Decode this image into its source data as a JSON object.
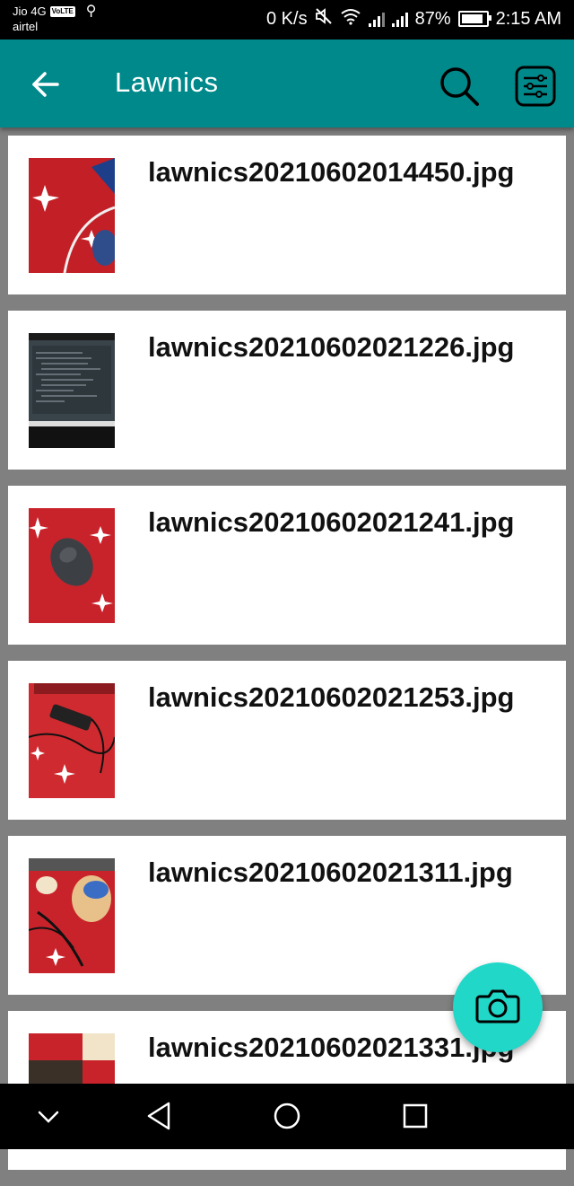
{
  "status_bar": {
    "carrier1": "Jio 4G",
    "volte": "VoLTE",
    "carrier2": "airtel",
    "speed": "0 K/s",
    "battery": "87%",
    "time": "2:15 AM",
    "battery_level": 0.87
  },
  "app_bar": {
    "title": "Lawnics",
    "back_icon": "arrow-left-icon",
    "search_icon": "search-icon",
    "filter_icon": "filter-icon",
    "color": "#00898a"
  },
  "files": [
    {
      "name": "lawnics20210602014450.jpg",
      "thumb": "red-blanket-cable"
    },
    {
      "name": "lawnics20210602021226.jpg",
      "thumb": "laptop-screen"
    },
    {
      "name": "lawnics20210602021241.jpg",
      "thumb": "mouse-on-red-blanket"
    },
    {
      "name": "lawnics20210602021253.jpg",
      "thumb": "phone-on-red-blanket"
    },
    {
      "name": "lawnics20210602021311.jpg",
      "thumb": "cartoon-blanket-cable"
    },
    {
      "name": "lawnics20210602021331.jpg",
      "thumb": "red-blanket-partial"
    }
  ],
  "fab": {
    "icon": "camera-icon",
    "color": "#20d7c8"
  },
  "nav_bar": {
    "icons": [
      "chevron-down-icon",
      "back-triangle-icon",
      "home-circle-icon",
      "recents-square-icon"
    ]
  }
}
